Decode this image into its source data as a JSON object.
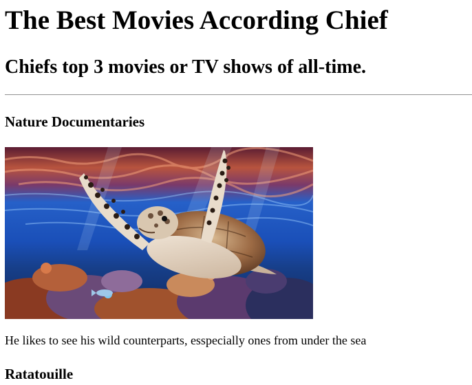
{
  "page": {
    "title": "The Best Movies According Chief",
    "subtitle": "Chiefs top 3 movies or TV shows of all-time."
  },
  "entries": [
    {
      "heading": "Nature Documentaries",
      "image": "sea-turtle-over-coral-reef",
      "description": "He likes to see his wild counterparts, esspecially ones from under the sea"
    },
    {
      "heading": "Ratatouille"
    }
  ],
  "colors": {
    "divider": "#9a9a9a",
    "text": "#000000",
    "background": "#ffffff"
  }
}
